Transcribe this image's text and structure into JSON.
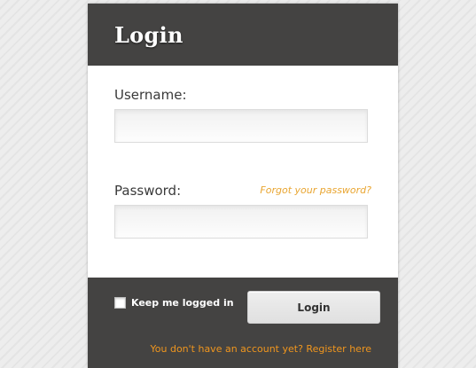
{
  "header": {
    "title": "Login"
  },
  "form": {
    "username_label": "Username:",
    "username_value": "",
    "password_label": "Password:",
    "password_value": "",
    "forgot_link": "Forgot your password?"
  },
  "footer": {
    "remember_label": "Keep me logged in",
    "remember_checked": false,
    "login_button": "Login",
    "register_link": "You don't have an account yet? Register here"
  },
  "colors": {
    "panel_dark": "#444342",
    "link_orange": "#e9a530",
    "register_orange": "#f0961e",
    "background": "#ececec"
  }
}
